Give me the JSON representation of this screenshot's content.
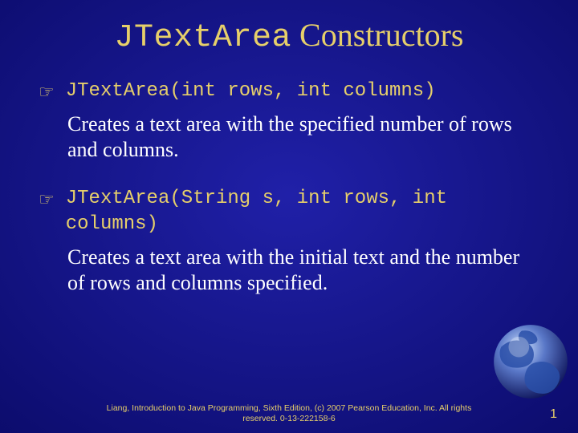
{
  "title": {
    "mono": "JTextArea",
    "rest": " Constructors"
  },
  "items": [
    {
      "sig": "JTextArea(int rows, int columns)",
      "desc": "Creates a text area with the specified number of rows and columns."
    },
    {
      "sig": "JTextArea(String s, int rows, int columns)",
      "desc": "Creates a text area with the initial text and the number of rows and columns specified."
    }
  ],
  "bullet": "☞",
  "footer": "Liang, Introduction to Java Programming, Sixth Edition, (c) 2007 Pearson Education, Inc. All rights reserved. 0-13-222158-6",
  "page": "1",
  "colors": {
    "accent": "#e6cf6a"
  }
}
